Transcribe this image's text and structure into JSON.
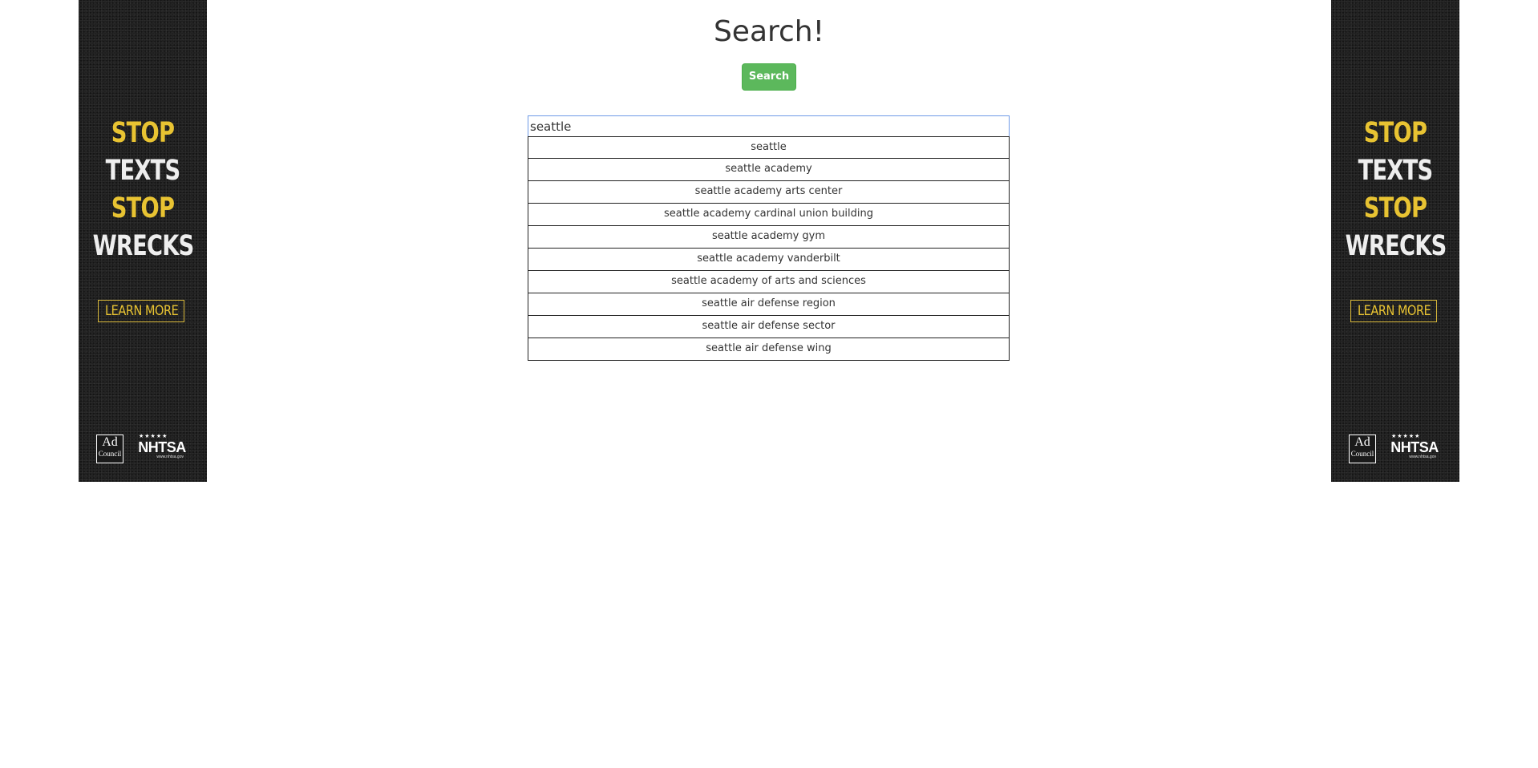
{
  "page": {
    "title": "Search!"
  },
  "search": {
    "button_label": "Search",
    "input_value": "seattle"
  },
  "suggestions": [
    "seattle",
    "seattle academy",
    "seattle academy arts center",
    "seattle academy cardinal union building",
    "seattle academy gym",
    "seattle academy vanderbilt",
    "seattle academy of arts and sciences",
    "seattle air defense region",
    "seattle air defense sector",
    "seattle air defense wing"
  ],
  "ad": {
    "headline": [
      "STOP",
      "TEXTS",
      "STOP",
      "WRECKS"
    ],
    "cta": "LEARN MORE",
    "logo_adcouncil": "Ad Council",
    "logo_nhtsa": "NHTSA",
    "logo_nhtsa_url": "www.nhtsa.gov",
    "colors": {
      "background": "#1d1d1d",
      "accent_yellow": "#e8c332",
      "text_white": "#eeeeee"
    }
  },
  "colors": {
    "search_button": "#5cb85c",
    "input_focus_border": "#6f9ae6",
    "suggestion_border": "#222222",
    "text": "#333333"
  }
}
